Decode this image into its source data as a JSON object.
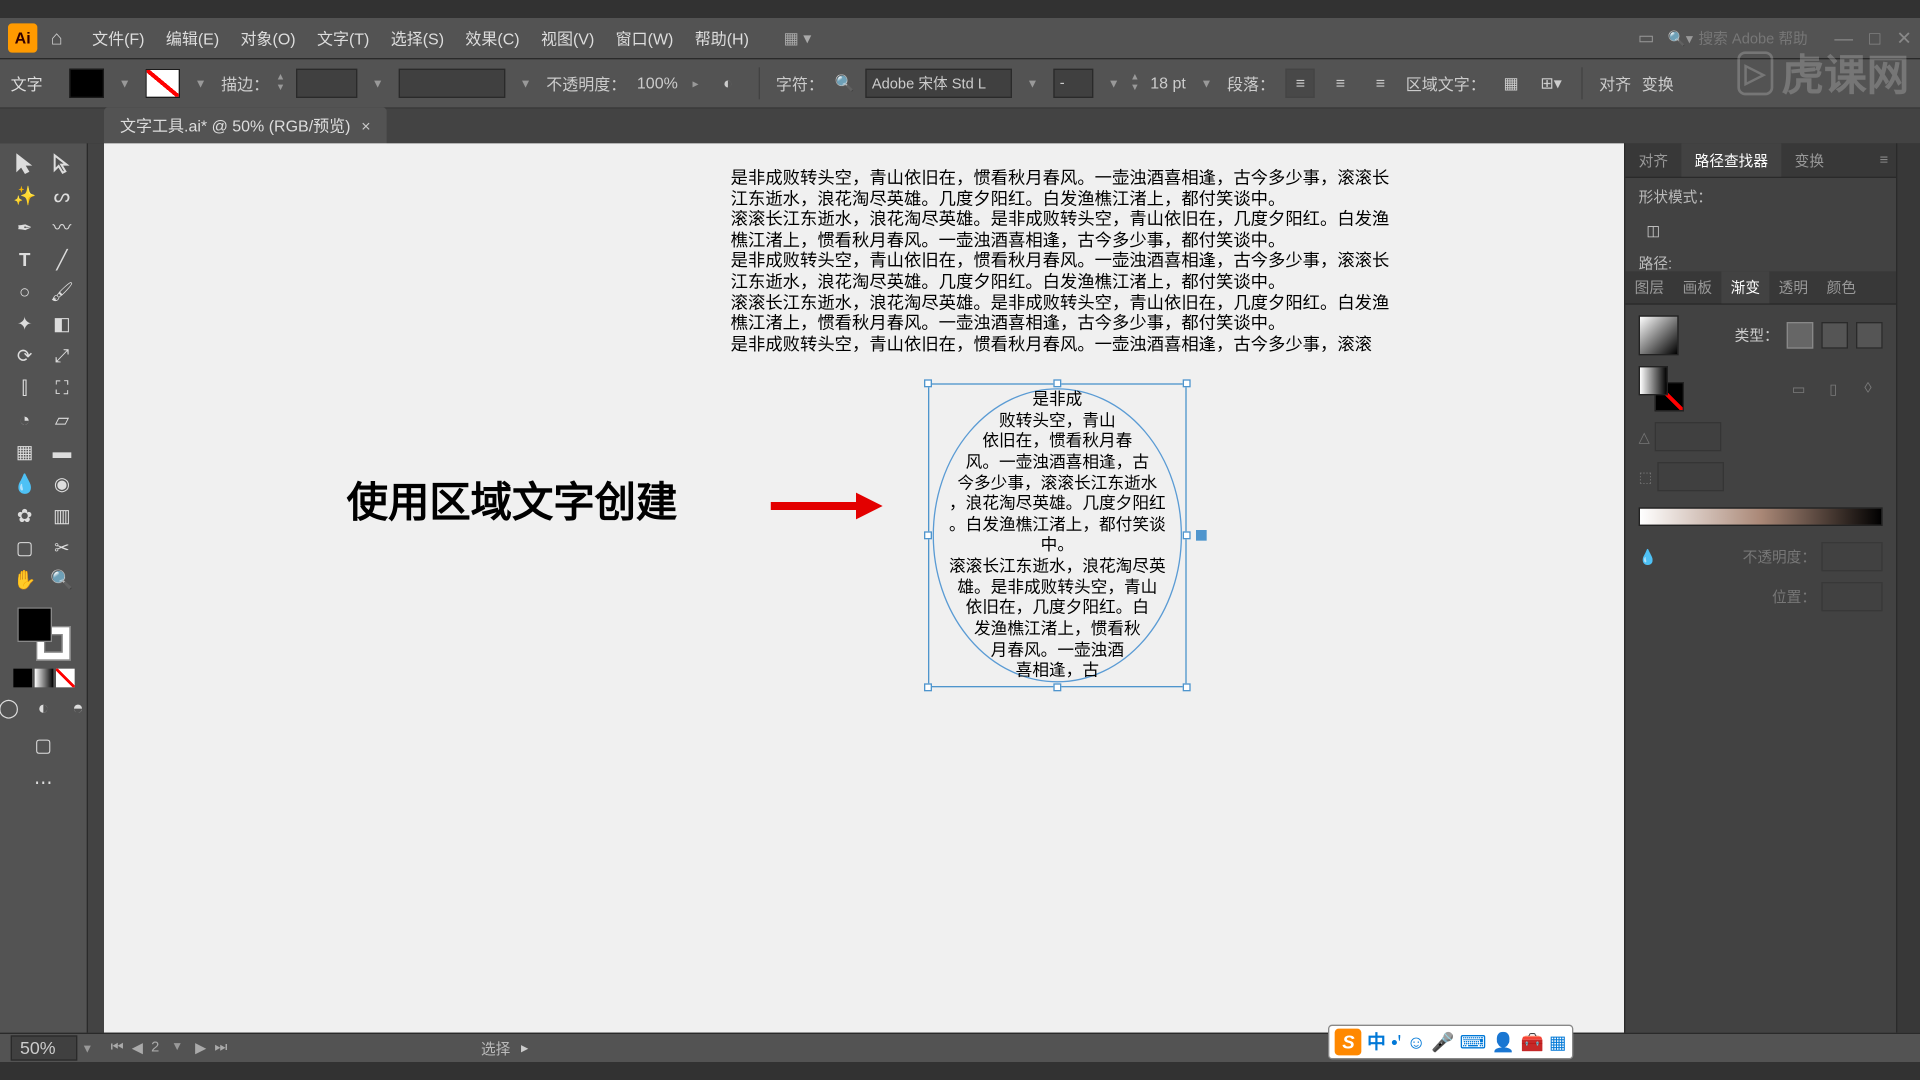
{
  "menu": {
    "file": "文件(F)",
    "edit": "编辑(E)",
    "object": "对象(O)",
    "type": "文字(T)",
    "select": "选择(S)",
    "effect": "效果(C)",
    "view": "视图(V)",
    "window": "窗口(W)",
    "help": "帮助(H)"
  },
  "search_placeholder": "搜索 Adobe 帮助",
  "control": {
    "tool_name": "文字",
    "stroke_label": "描边：",
    "opacity_label": "不透明度：",
    "opacity_value": "100%",
    "char_label": "字符：",
    "font": "Adobe 宋体 Std L",
    "font_style": "-",
    "font_size": "18 pt",
    "para_label": "段落：",
    "area_type_label": "区域文字：",
    "align_label": "对齐",
    "transform_label": "变换"
  },
  "doc_tab": "文字工具.ai* @ 50% (RGB/预览)",
  "canvas_text": "是非成败转头空，青山依旧在，惯看秋月春风。一壶浊酒喜相逢，古今多少事，滚滚长江东逝水，浪花淘尽英雄。几度夕阳红。白发渔樵江渚上，都付笑谈中。\n滚滚长江东逝水，浪花淘尽英雄。是非成败转头空，青山依旧在，几度夕阳红。白发渔樵江渚上，惯看秋月春风。一壶浊酒喜相逢，古今多少事，都付笑谈中。\n是非成败转头空，青山依旧在，惯看秋月春风。一壶浊酒喜相逢，古今多少事，滚滚长江东逝水，浪花淘尽英雄。几度夕阳红。白发渔樵江渚上，都付笑谈中。\n滚滚长江东逝水，浪花淘尽英雄。是非成败转头空，青山依旧在，几度夕阳红。白发渔樵江渚上，惯看秋月春风。一壶浊酒喜相逢，古今多少事，都付笑谈中。\n是非成败转头空，青山依旧在，惯看秋月春风。一壶浊酒喜相逢，古今多少事，滚滚",
  "area_text": "是非成\n败转头空，青山\n依旧在，惯看秋月春\n风。一壶浊酒喜相逢，古\n今多少事，滚滚长江东逝水\n，浪花淘尽英雄。几度夕阳红\n。白发渔樵江渚上，都付笑谈\n中。\n滚滚长江东逝水，浪花淘尽英\n雄。是非成败转头空，青山\n依旧在，几度夕阳红。白\n发渔樵江渚上，惯看秋\n月春风。一壶浊酒\n喜相逢，古",
  "annotation": "使用区域文字创建",
  "right_panel": {
    "tabs": [
      "对齐",
      "路径查找器",
      "变换"
    ],
    "shape_mode": "形状模式：",
    "pathfinder": "路径:",
    "tab2": [
      "图层",
      "画板",
      "渐变",
      "透明",
      "颜色"
    ],
    "type_label": "类型：",
    "opacity_label": "不透明度：",
    "position_label": "位置："
  },
  "statusbar": {
    "zoom": "50%",
    "page": "2",
    "selection": "选择"
  },
  "ime": {
    "mode": "中"
  },
  "watermark": "虎课网"
}
